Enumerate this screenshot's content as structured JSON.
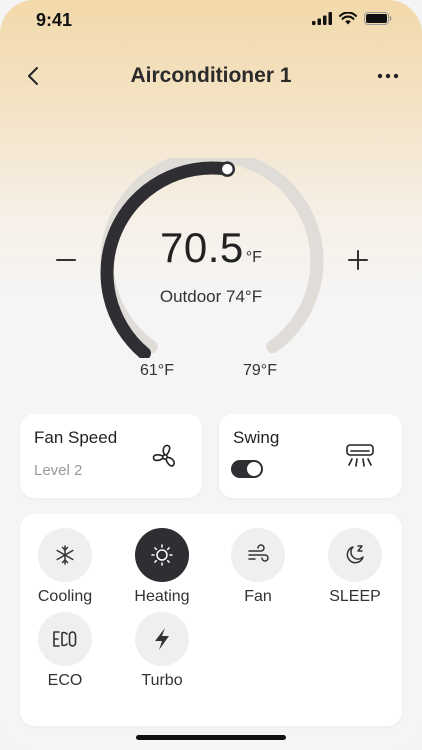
{
  "status_bar": {
    "time": "9:41"
  },
  "header": {
    "title": "Airconditioner 1"
  },
  "thermostat": {
    "temperature": "70.5",
    "unit": "°F",
    "outdoor_label": "Outdoor 74°F",
    "min_label": "61°F",
    "max_label": "79°F",
    "setpoint_fraction": 0.53
  },
  "fan_speed": {
    "title": "Fan Speed",
    "value": "Level 2"
  },
  "swing": {
    "title": "Swing",
    "enabled": true
  },
  "modes": [
    {
      "label": "Cooling",
      "icon": "snowflake-icon",
      "active": false
    },
    {
      "label": "Heating",
      "icon": "sun-icon",
      "active": true
    },
    {
      "label": "Fan",
      "icon": "wind-icon",
      "active": false
    },
    {
      "label": "SLEEP",
      "icon": "moon-icon",
      "active": false
    },
    {
      "label": "ECO",
      "icon": "eco-icon",
      "active": false
    },
    {
      "label": "Turbo",
      "icon": "lightning-icon",
      "active": false
    }
  ],
  "colors": {
    "active": "#2f2f33",
    "track": "#e0ddd8",
    "background_top": "#f2d9aa"
  }
}
